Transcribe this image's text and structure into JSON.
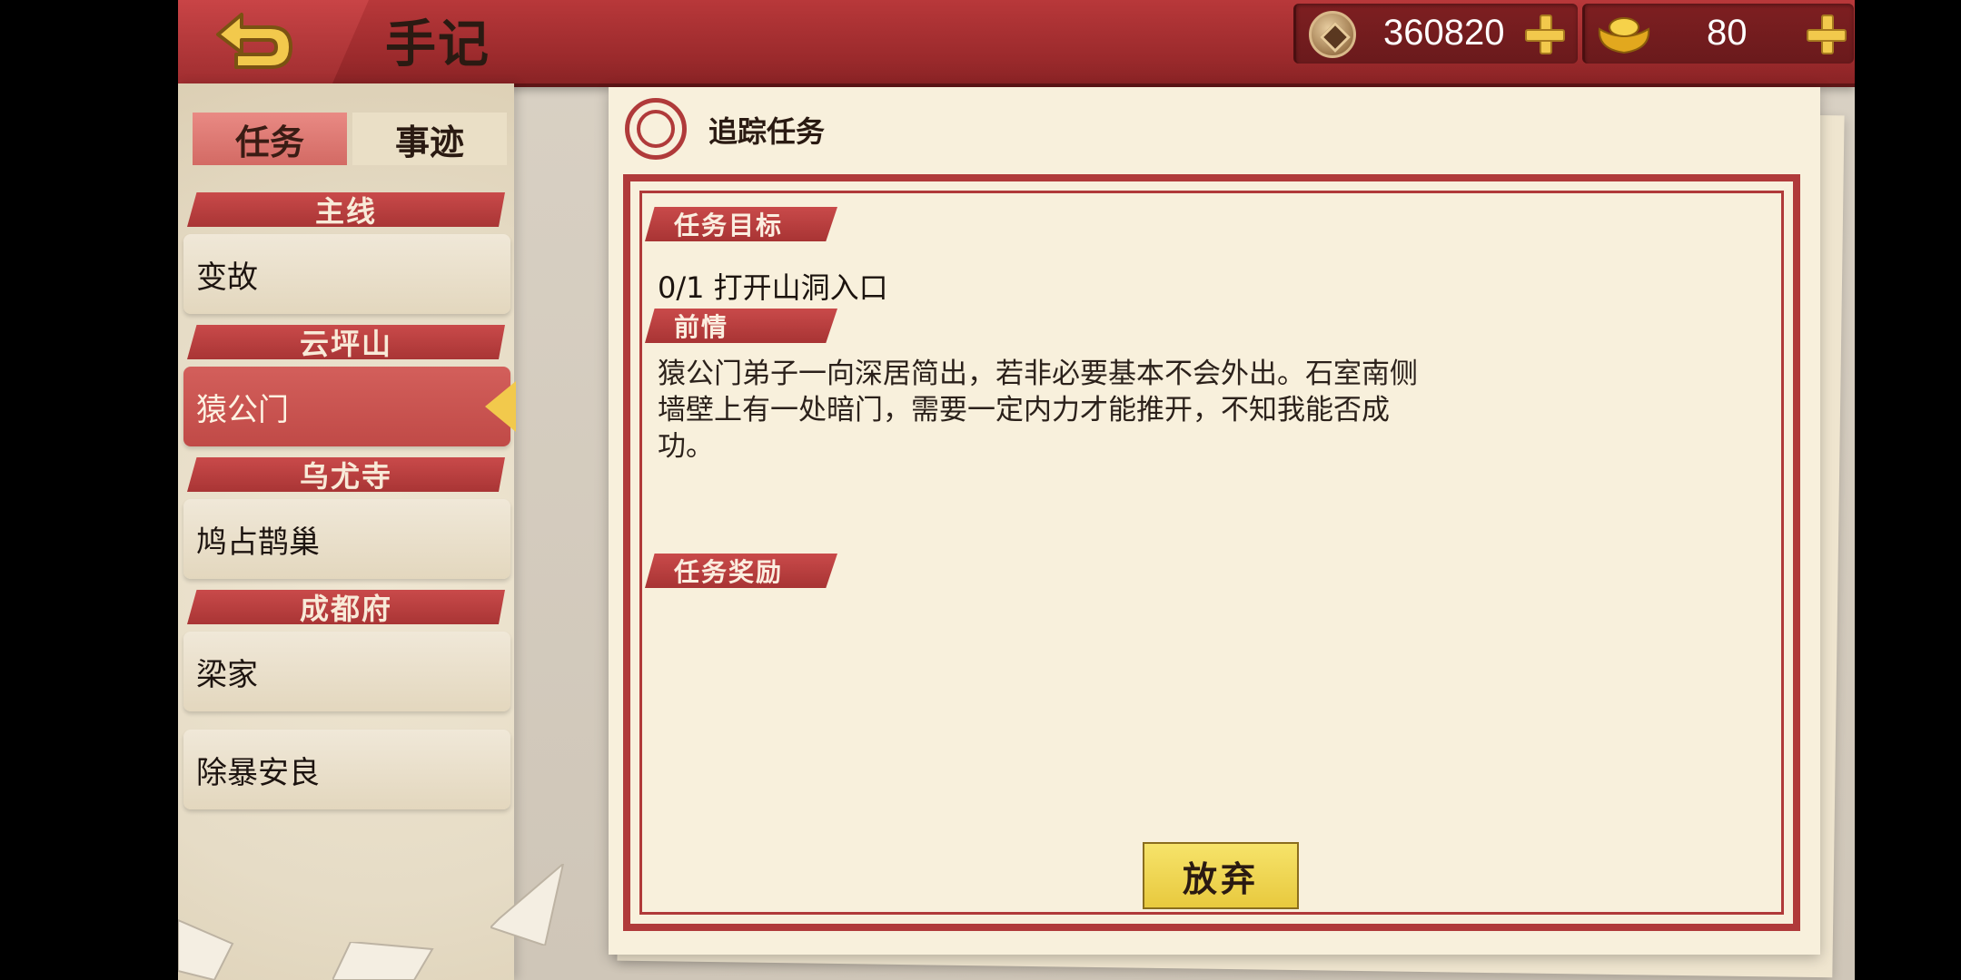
{
  "header": {
    "title": "手记",
    "back_icon": "back-arrow-icon",
    "currencies": [
      {
        "icon": "coin-icon",
        "value": "360820"
      },
      {
        "icon": "gold-ingot-icon",
        "value": "80"
      }
    ]
  },
  "tabs": [
    {
      "label": "任务",
      "active": true
    },
    {
      "label": "事迹",
      "active": false
    }
  ],
  "quest_list": {
    "sections": [
      {
        "header": "主线",
        "items": [
          "变故"
        ]
      },
      {
        "header": "云坪山",
        "items": [
          "猿公门"
        ]
      },
      {
        "header": "乌尤寺",
        "items": [
          "鸠占鹊巢"
        ]
      },
      {
        "header": "成都府",
        "items": [
          "梁家",
          "除暴安良"
        ]
      }
    ],
    "selected": "猿公门"
  },
  "detail": {
    "title": "追踪任务",
    "objective_label": "任务目标",
    "objective": "0/1 打开山洞入口",
    "story_label": "前情",
    "story": "猿公门弟子一向深居简出，若非必要基本不会外出。石室南侧墙壁上有一处暗门，需要一定内力才能推开，不知我能否成功。",
    "reward_label": "任务奖励",
    "abandon_label": "放弃"
  },
  "colors": {
    "accent_red": "#b03a3a",
    "paper": "#f8f0dc",
    "button_yellow": "#f2d54e"
  }
}
